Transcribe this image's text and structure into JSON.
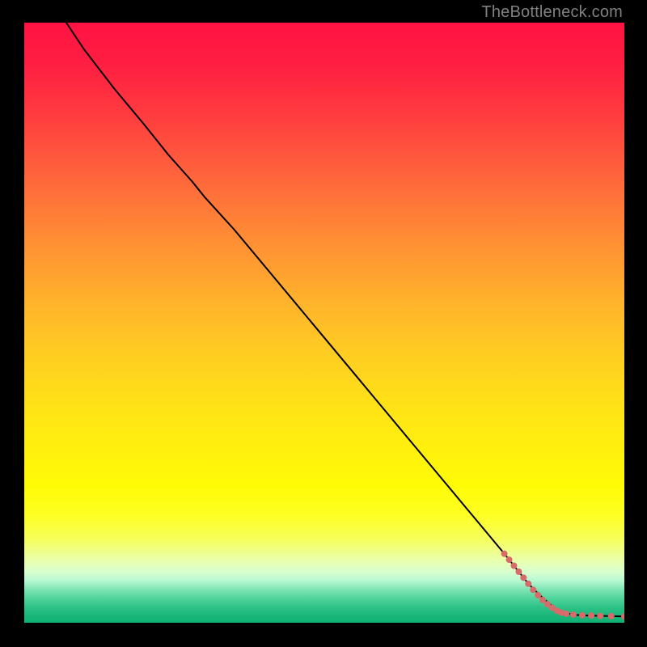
{
  "watermark": "TheBottleneck.com",
  "chart_data": {
    "type": "line",
    "title": "",
    "xlabel": "",
    "ylabel": "",
    "xlim": [
      0,
      100
    ],
    "ylim": [
      0,
      100
    ],
    "grid": false,
    "legend": false,
    "series": [
      {
        "name": "curve",
        "type": "line",
        "color": "#000000",
        "x": [
          7,
          10,
          15,
          20,
          24,
          28,
          30,
          35,
          40,
          45,
          50,
          55,
          60,
          65,
          70,
          75,
          80,
          84,
          86,
          88.5,
          90,
          92,
          94,
          96,
          98,
          100
        ],
        "y": [
          100,
          95.5,
          89,
          83,
          78,
          73.5,
          71,
          65.5,
          59.5,
          53.5,
          47.5,
          41.5,
          35.5,
          29.5,
          23.5,
          17.5,
          11.5,
          6.5,
          4.5,
          2.3,
          1.6,
          1.3,
          1.2,
          1.15,
          1.1,
          1.05
        ]
      },
      {
        "name": "markers",
        "type": "scatter",
        "color": "#d86a6a",
        "points": [
          {
            "x": 80.0,
            "y": 11.5,
            "r": 4
          },
          {
            "x": 80.8,
            "y": 10.5,
            "r": 4
          },
          {
            "x": 81.6,
            "y": 9.5,
            "r": 4
          },
          {
            "x": 82.4,
            "y": 8.5,
            "r": 4
          },
          {
            "x": 83.2,
            "y": 7.5,
            "r": 4
          },
          {
            "x": 84.0,
            "y": 6.5,
            "r": 4
          },
          {
            "x": 84.8,
            "y": 5.5,
            "r": 4
          },
          {
            "x": 85.6,
            "y": 4.6,
            "r": 4
          },
          {
            "x": 86.4,
            "y": 3.8,
            "r": 4
          },
          {
            "x": 87.2,
            "y": 3.1,
            "r": 4
          },
          {
            "x": 88.0,
            "y": 2.5,
            "r": 4
          },
          {
            "x": 88.8,
            "y": 2.0,
            "r": 4
          },
          {
            "x": 89.5,
            "y": 1.7,
            "r": 4
          },
          {
            "x": 90.3,
            "y": 1.5,
            "r": 4
          },
          {
            "x": 91.5,
            "y": 1.35,
            "r": 4
          },
          {
            "x": 93.0,
            "y": 1.25,
            "r": 4
          },
          {
            "x": 94.5,
            "y": 1.2,
            "r": 4
          },
          {
            "x": 96.0,
            "y": 1.15,
            "r": 4
          },
          {
            "x": 97.8,
            "y": 1.1,
            "r": 4
          },
          {
            "x": 100.0,
            "y": 1.05,
            "r": 4
          }
        ]
      }
    ],
    "background_bands": [
      {
        "name": "red-orange-yellow-green vertical gradient",
        "from_y": 0,
        "to_y": 100
      }
    ]
  }
}
